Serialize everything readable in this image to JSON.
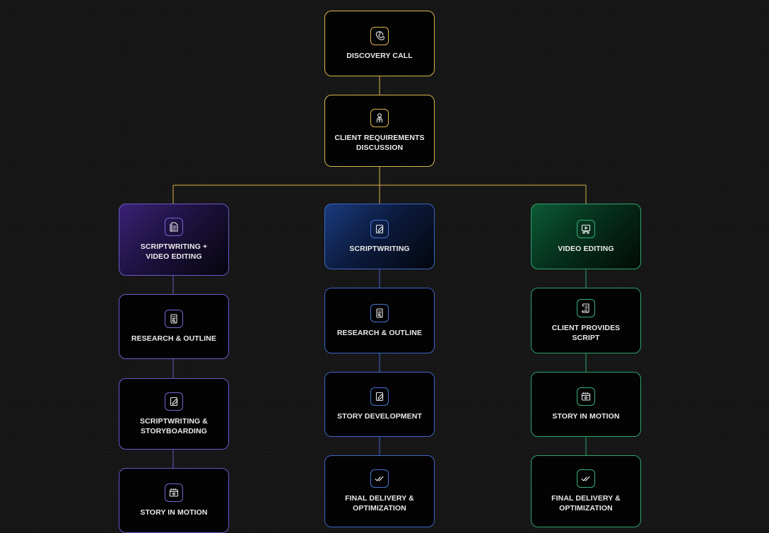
{
  "colors": {
    "gold": "#d9b44a",
    "purple": "#6f56c9",
    "blue": "#3c66c4",
    "green": "#2fa36c",
    "background": "#141414"
  },
  "flow": {
    "discovery": {
      "label": "DISCOVERY CALL",
      "icon": "phone-icon"
    },
    "requirements": {
      "label": "CLIENT REQUIREMENTS DISCUSSION",
      "icon": "people-icon"
    },
    "branch_scriptwriting_video": {
      "title": "SCRIPTWRITING + VIDEO EDITING",
      "icon": "document-icon",
      "steps": [
        {
          "label": "RESEARCH & OUTLINE",
          "icon": "file-icon"
        },
        {
          "label": "SCRIPTWRITING & STORYBOARDING",
          "icon": "edit-icon"
        },
        {
          "label": "STORY IN MOTION",
          "icon": "film-icon"
        }
      ]
    },
    "branch_scriptwriting": {
      "title": "SCRIPTWRITING",
      "icon": "edit-icon",
      "steps": [
        {
          "label": "RESEARCH & OUTLINE",
          "icon": "file-icon"
        },
        {
          "label": "STORY DEVELOPMENT",
          "icon": "edit-icon"
        },
        {
          "label": "FINAL DELIVERY & OPTIMIZATION",
          "icon": "checkmark-icon"
        }
      ]
    },
    "branch_video": {
      "title": "VIDEO EDITING",
      "icon": "video-edit-icon",
      "steps": [
        {
          "label": "CLIENT PROVIDES SCRIPT",
          "icon": "scroll-icon"
        },
        {
          "label": "STORY IN MOTION",
          "icon": "film-icon"
        },
        {
          "label": "FINAL DELIVERY & OPTIMIZATION",
          "icon": "checkmark-icon"
        }
      ]
    }
  }
}
